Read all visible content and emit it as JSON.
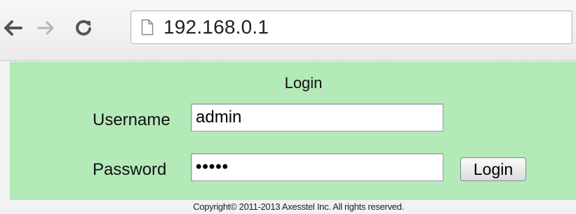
{
  "browser": {
    "url": "192.168.0.1",
    "icons": [
      "back-arrow-icon",
      "forward-arrow-icon",
      "reload-icon",
      "page-icon"
    ]
  },
  "login": {
    "title": "Login",
    "username_label": "Username",
    "username_value": "admin",
    "password_label": "Password",
    "password_value": "•••••",
    "button_label": "Login"
  },
  "footer": {
    "copyright": "Copyright© 2011-2013 Axesstel Inc. All rights reserved."
  },
  "colors": {
    "panel_background": "#b4e9b8",
    "toolbar_background": "#efefef"
  }
}
